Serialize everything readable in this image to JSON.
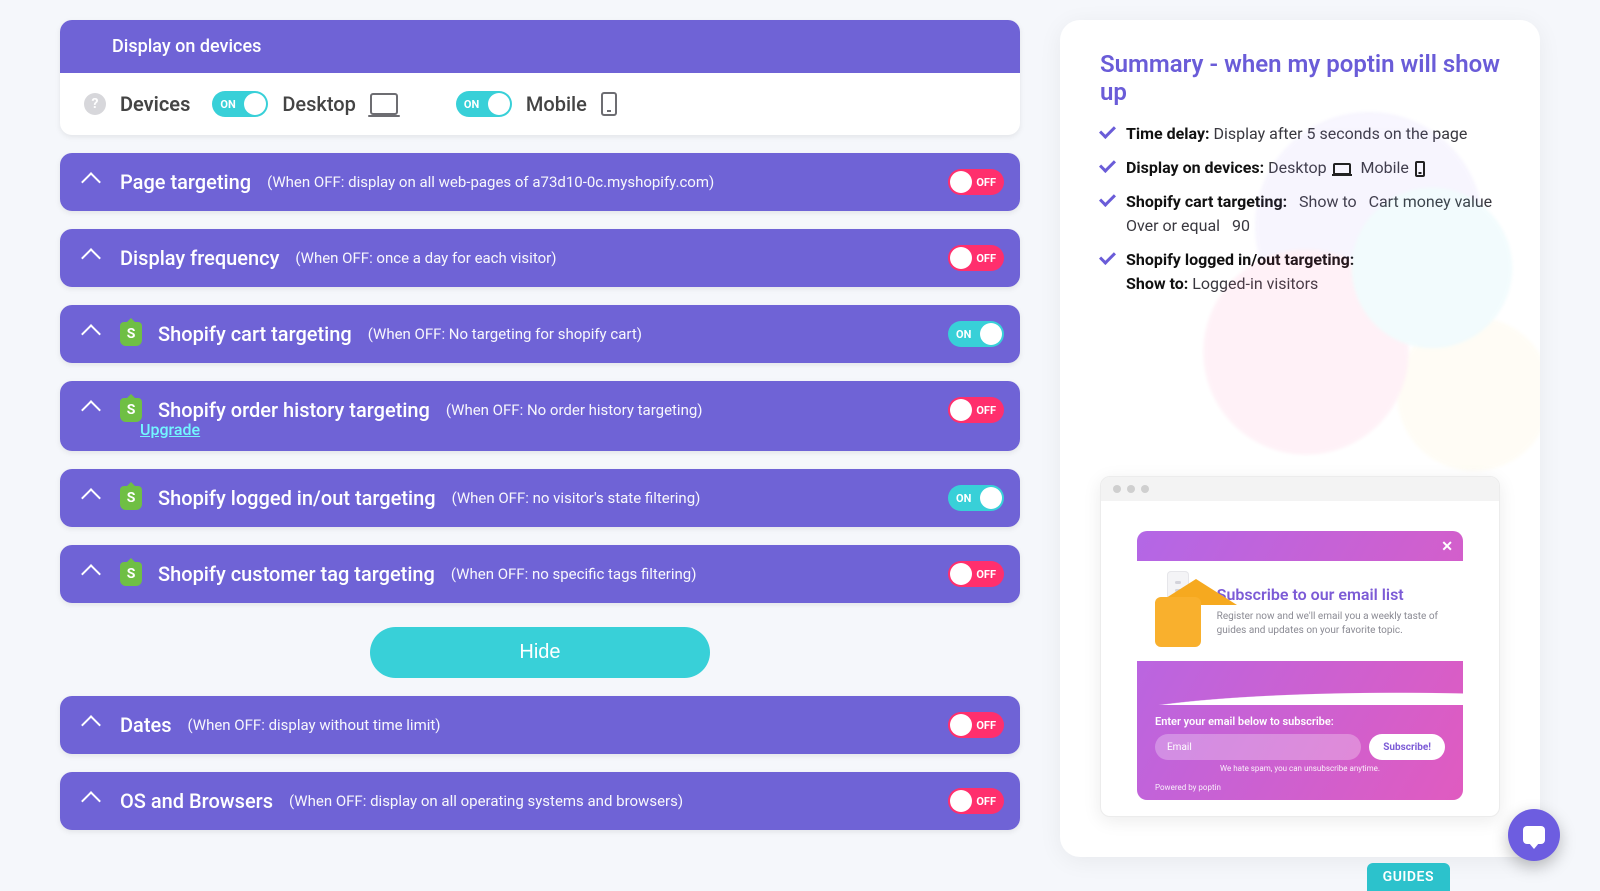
{
  "devicesCard": {
    "header": "Display on devices",
    "label": "Devices",
    "toggleLabel": "ON",
    "desktop": "Desktop",
    "mobile": "Mobile"
  },
  "toggles": {
    "onLabel": "ON",
    "offLabel": "OFF"
  },
  "rules": {
    "pageTargeting": {
      "title": "Page targeting",
      "sub": "(When OFF: display on all web-pages of a73d10-0c.myshopify.com)",
      "state": "OFF"
    },
    "displayFrequency": {
      "title": "Display frequency",
      "sub": "(When OFF: once a day for each visitor)",
      "state": "OFF"
    },
    "shopifyCart": {
      "title": "Shopify cart targeting",
      "sub": "(When OFF: No targeting for shopify cart)",
      "state": "ON"
    },
    "shopifyOrderHistory": {
      "title": "Shopify order history targeting",
      "sub": "(When OFF: No order history targeting)",
      "upgrade": "Upgrade",
      "state": "OFF"
    },
    "shopifyLogged": {
      "title": "Shopify logged in/out targeting",
      "sub": "(When OFF: no visitor's state filtering)",
      "state": "ON"
    },
    "shopifyCustomerTag": {
      "title": "Shopify customer tag targeting",
      "sub": "(When OFF: no specific tags filtering)",
      "state": "OFF"
    },
    "dates": {
      "title": "Dates",
      "sub": "(When OFF: display without time limit)",
      "state": "OFF"
    },
    "osBrowsers": {
      "title": "OS and Browsers",
      "sub": "(When OFF: display on all operating systems and browsers)",
      "state": "OFF"
    }
  },
  "hideButton": "Hide",
  "summary": {
    "title": "Summary - when my poptin will show up",
    "timeDelay": {
      "label": "Time delay:",
      "value": "Display after 5 seconds on the page"
    },
    "devices": {
      "label": "Display on devices:",
      "desktop": "Desktop",
      "mobile": "Mobile"
    },
    "cart": {
      "label": "Shopify cart targeting:",
      "line1a": "Show to",
      "line1b": "Cart money value",
      "line2a": "Over or equal",
      "line2b": "90"
    },
    "logged": {
      "label": "Shopify logged in/out targeting:",
      "line2a": "Show to:",
      "line2b": "Logged-in visitors"
    }
  },
  "popup": {
    "heading": "Subscribe to our email list",
    "body": "Register now and we'll email you a weekly taste of guides and updates on your favorite topic.",
    "footerLabel": "Enter your email below to subscribe:",
    "emailPlaceholder": "Email",
    "subscribe": "Subscribe!",
    "tiny": "We hate spam, you can unsubscribe anytime.",
    "powered": "Powered by poptin"
  },
  "guidesTab": "GUIDES"
}
